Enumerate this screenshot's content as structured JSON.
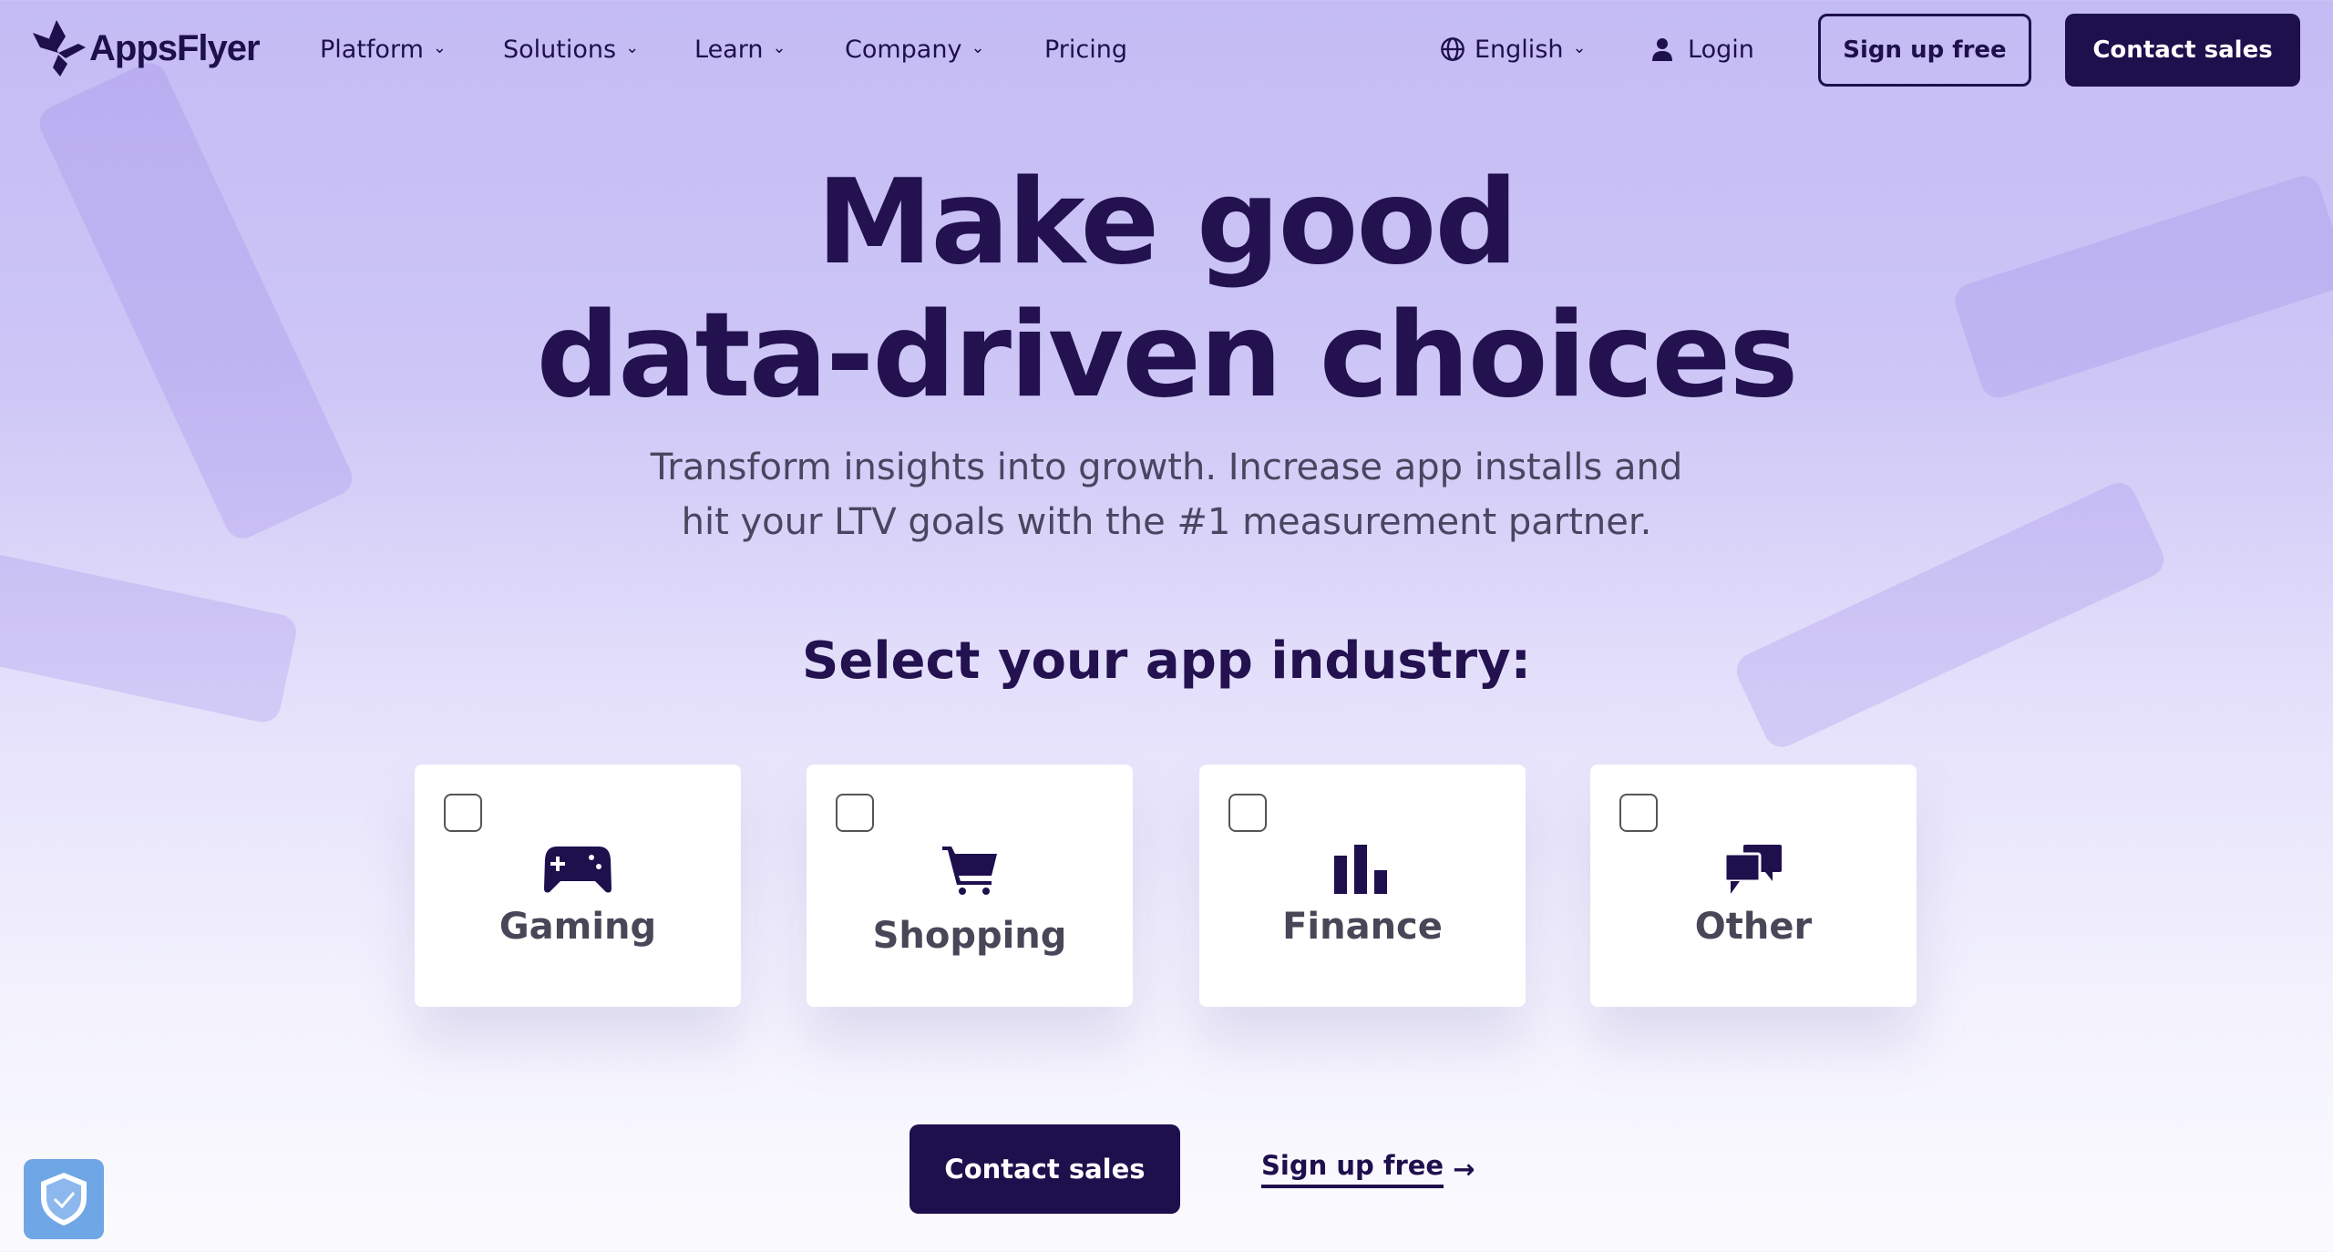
{
  "colors": {
    "brand": "#1e0f4d",
    "background_top": "#c4bbf4",
    "background_bottom": "#fbfbff"
  },
  "header": {
    "logo_text": "AppsFlyer",
    "nav": [
      {
        "label": "Platform",
        "dropdown": true
      },
      {
        "label": "Solutions",
        "dropdown": true
      },
      {
        "label": "Learn",
        "dropdown": true
      },
      {
        "label": "Company",
        "dropdown": true
      },
      {
        "label": "Pricing",
        "dropdown": false
      }
    ],
    "language": "English",
    "login": "Login",
    "signup": "Sign up free",
    "contact": "Contact sales"
  },
  "hero": {
    "title_line1": "Make good",
    "title_line2": "data-driven choices",
    "subtitle_line1": "Transform insights into growth. Increase app installs and",
    "subtitle_line2": "hit your LTV goals with the #1 measurement partner.",
    "select_heading": "Select your app industry:",
    "industries": [
      {
        "label": "Gaming",
        "icon": "gamepad-icon",
        "checked": false
      },
      {
        "label": "Shopping",
        "icon": "shopping-cart-icon",
        "checked": false
      },
      {
        "label": "Finance",
        "icon": "bar-chart-icon",
        "checked": false
      },
      {
        "label": "Other",
        "icon": "chat-bubbles-icon",
        "checked": false
      }
    ],
    "cta_contact": "Contact sales",
    "cta_signup": "Sign up free",
    "cta_signup_arrow": "→"
  }
}
